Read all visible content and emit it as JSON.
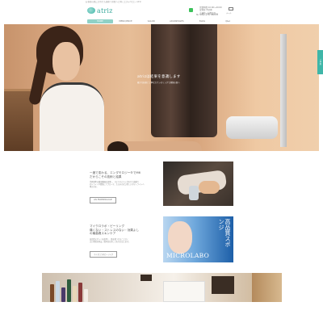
{
  "header": {
    "tagline": "お客様の肌に合わせた施術で美肌へと導くエステサロン atriz",
    "logo_text": "atriz",
    "contact_lines": [
      "営業時間 10:00〜20:00",
      "定休日 不定休",
      "ご予約・お問合せ"
    ],
    "mail_label": "メール",
    "tel": "℡ 082-237-6059"
  },
  "nav": {
    "items": [
      "HOME",
      "MENU/PRICE",
      "SALON",
      "ADVANTAGES",
      "BLOG",
      "Q&A"
    ]
  },
  "hero": {
    "title": "atrizは結果を意識します",
    "subtitle": "確かな技術と丁寧なカウンセリングで理想の肌へ",
    "side_tab": "ご予約"
  },
  "section1": {
    "title_lines": [
      "一度で変わる、エンダモロジー®でM6",
      "だからこその技術と結果"
    ],
    "body_lines": [
      "世界基準の痩身機器を使用し、ひとりひとりに合わせた施術で",
      "セルライトや脂肪にアプローチ、たるみのない美しいボディラインへ",
      "導きます。"
    ],
    "button": "LPG ENDERMOLOGIE"
  },
  "section2": {
    "title_lines": [
      "マイクロラボ・ピーリング",
      "痛くない・ストレスのない・効果よし",
      "の最高峰スキンケア"
    ],
    "body_lines": [
      "高品質スポンジを使用し、肌を傷つけることなく",
      "古い角質を除去。肌本来の美しさを引き出します。"
    ],
    "button": "マイクロラボピーリング",
    "image_brand": "MICROLABO",
    "image_jp": "高品質スポンジ"
  },
  "colors": {
    "accent": "#3fb6a8",
    "nav_active": "#8fd1c6"
  }
}
